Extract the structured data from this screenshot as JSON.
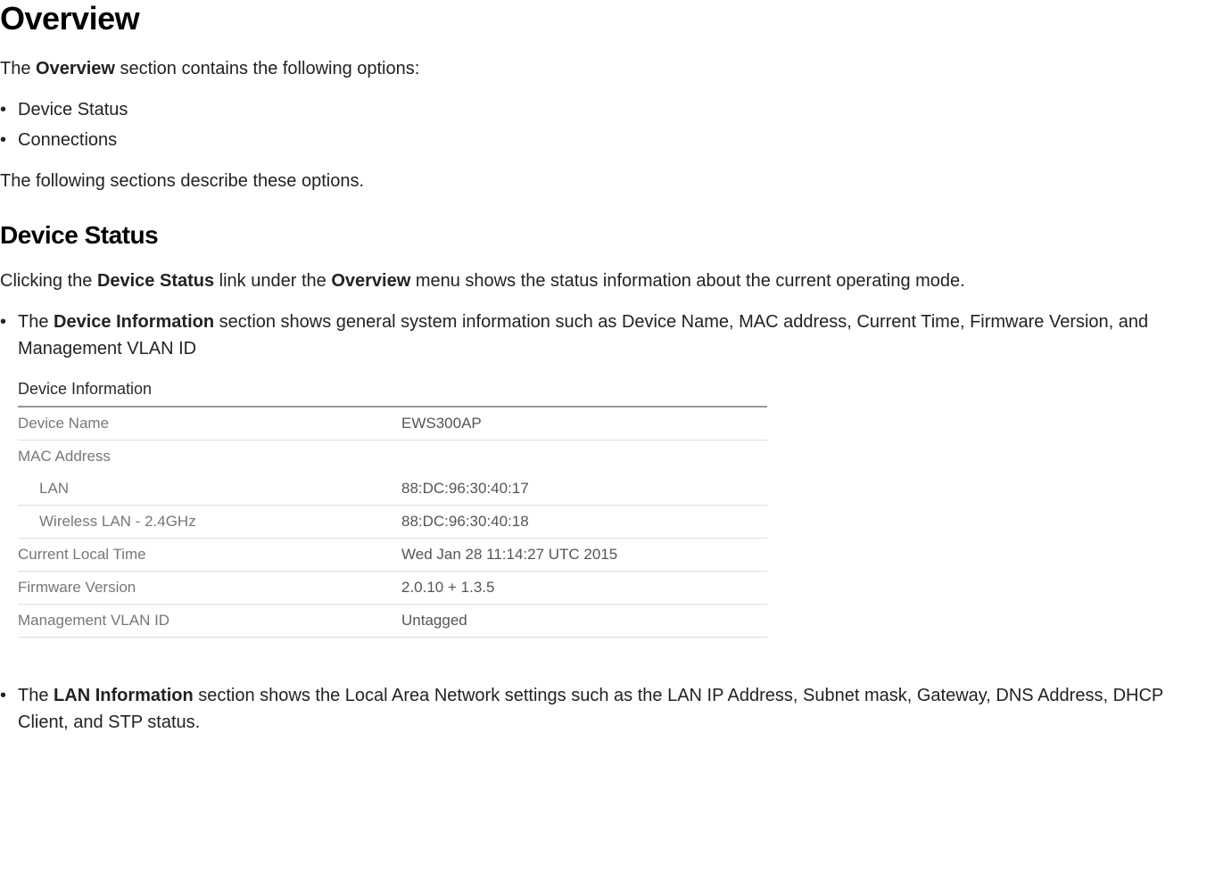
{
  "heading1": "Overview",
  "intro_prefix": "The ",
  "intro_bold": "Overview",
  "intro_suffix": " section contains the following options:",
  "options": [
    "Device Status",
    "Connections"
  ],
  "desc_text": "The following sections describe these options.",
  "heading2": "Device Status",
  "device_status_p1_prefix": "Clicking the ",
  "device_status_p1_bold1": "Device Status",
  "device_status_p1_mid": " link under the ",
  "device_status_p1_bold2": "Overview",
  "device_status_p1_suffix": " menu shows the status information about the current operating mode.",
  "bullet_di_prefix": "The ",
  "bullet_di_bold": "Device Information",
  "bullet_di_suffix": " section shows general system information such as Device Name, MAC address, Current Time, Firmware Version, and Management VLAN ID",
  "device_info": {
    "title": "Device Information",
    "rows": [
      {
        "label": "Device Name",
        "value": "EWS300AP",
        "indent": false
      },
      {
        "label": "MAC Address",
        "value": "",
        "indent": false
      },
      {
        "label": "LAN",
        "value": "88:DC:96:30:40:17",
        "indent": true
      },
      {
        "label": "Wireless LAN - 2.4GHz",
        "value": "88:DC:96:30:40:18",
        "indent": true
      },
      {
        "label": "Current Local Time",
        "value": "Wed Jan 28 11:14:27 UTC 2015",
        "indent": false
      },
      {
        "label": "Firmware Version",
        "value": "2.0.10 + 1.3.5",
        "indent": false
      },
      {
        "label": "Management VLAN ID",
        "value": "Untagged",
        "indent": false
      }
    ]
  },
  "bullet_lan_prefix": "The ",
  "bullet_lan_bold": "LAN Information",
  "bullet_lan_suffix": " section shows the Local Area Network settings such as the LAN IP Address, Subnet mask, Gateway, DNS Address, DHCP Client, and STP status."
}
